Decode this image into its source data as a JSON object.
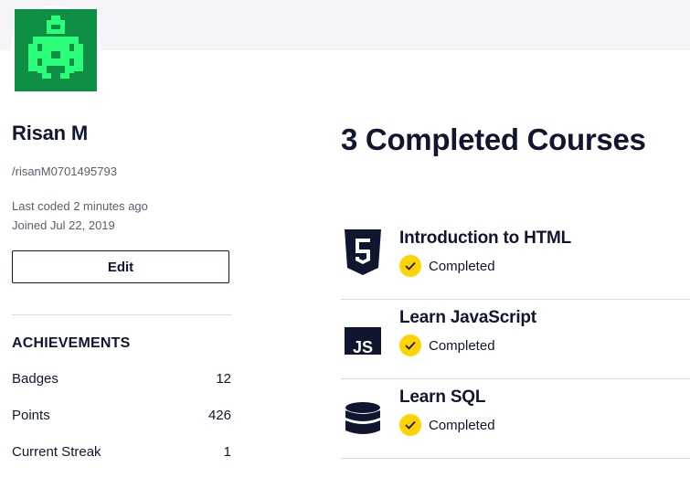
{
  "profile": {
    "name": "Risan M",
    "handle": "/risanM0701495793",
    "last_coded": "Last coded 2 minutes ago",
    "joined": "Joined Jul 22, 2019",
    "edit_label": "Edit",
    "avatar_icon": "pixel-robot-avatar-icon",
    "avatar_color": "#0f8f46"
  },
  "achievements": {
    "title": "ACHIEVEMENTS",
    "stats": [
      {
        "label": "Badges",
        "value": "12"
      },
      {
        "label": "Points",
        "value": "426"
      },
      {
        "label": "Current Streak",
        "value": "1"
      }
    ]
  },
  "courses": {
    "title": "3 Completed Courses",
    "items": [
      {
        "name": "Introduction to HTML",
        "status": "Completed",
        "icon": "html5-icon"
      },
      {
        "name": "Learn JavaScript",
        "status": "Completed",
        "icon": "javascript-icon"
      },
      {
        "name": "Learn SQL",
        "status": "Completed",
        "icon": "database-icon"
      }
    ],
    "status_color": "#ffd300"
  }
}
